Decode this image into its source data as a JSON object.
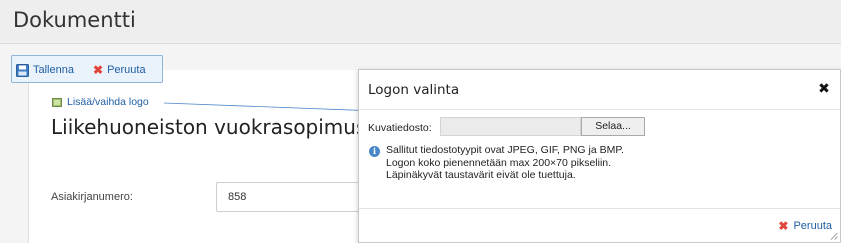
{
  "header": {
    "title": "Dokumentti"
  },
  "toolbar": {
    "save_label": "Tallenna",
    "cancel_label": "Peruuta"
  },
  "document": {
    "logo_link_label": "Lisää/vaihda logo",
    "title": "Liikehuoneiston vuokrasopimus",
    "fields": [
      {
        "label": "Asiakirjanumero:",
        "value": "858"
      }
    ]
  },
  "dialog": {
    "title": "Logon valinta",
    "file_label": "Kuvatiedosto:",
    "browse_label": "Selaa...",
    "info_lines": [
      "Sallitut tiedostotyypit ovat JPEG, GIF, PNG ja BMP.",
      "Logon koko pienennetään max 200×70 pikseliin.",
      "Läpinäkyvät taustavärit eivät ole tuettuja."
    ],
    "cancel_label": "Peruuta"
  },
  "colors": {
    "link": "#1f5fa3",
    "cancel_x": "#e0463c",
    "info": "#4a86c7"
  }
}
